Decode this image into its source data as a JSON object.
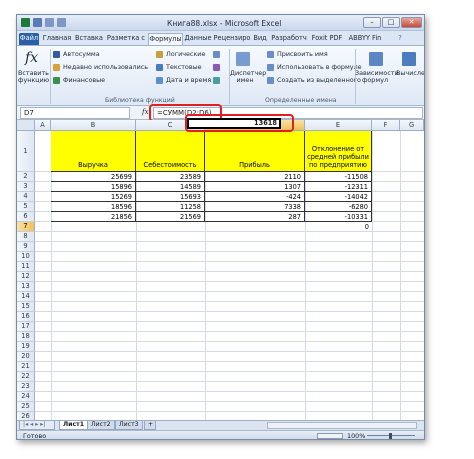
{
  "window": {
    "title": "Книга88.xlsx - Microsoft Excel",
    "minimize_label": "–",
    "restore_label": "□",
    "close_label": "✕"
  },
  "ribbon_tabs": [
    "Файл",
    "Главная",
    "Вставка",
    "Разметка с",
    "Формулы",
    "Данные",
    "Рецензиро",
    "Вид",
    "Разработч",
    "Foxit PDF",
    "ABBYY Fin"
  ],
  "active_tab": "Формулы",
  "ribbon": {
    "insert_function": "Вставить функцию",
    "autosum": "Автосумма",
    "recent": "Недавно использовались",
    "financial": "Финансовые",
    "logical": "Логические",
    "text": "Текстовые",
    "datetime": "Дата и время",
    "library_group": "Библиотека функций",
    "name_manager": "Диспетчер имен",
    "assign_name": "Присвоить имя",
    "use_in_formula": "Использовать в формуле",
    "create_from_selection": "Создать из выделенного",
    "defined_names_group": "Определенные имена",
    "dependencies": "Зависимости формул",
    "calculation": "Вычисление"
  },
  "formula_bar": {
    "name_box": "D7",
    "fx": "fx",
    "formula": "=СУММ(D2:D6)"
  },
  "columns": [
    "A",
    "B",
    "C",
    "D",
    "E",
    "F",
    "G"
  ],
  "selected_column": "D",
  "rows": [
    "1",
    "2",
    "3",
    "4",
    "5",
    "6",
    "7",
    "8",
    "9",
    "10",
    "11",
    "12",
    "13",
    "14",
    "15",
    "16",
    "17",
    "18",
    "19",
    "20",
    "21",
    "22",
    "23",
    "24",
    "25",
    "26",
    "27",
    "28",
    "29"
  ],
  "selected_row": "7",
  "table": {
    "headers": [
      "Выручка",
      "Себестоимость",
      "Прибыль",
      "Отклонение от средней прибыли по предприятию"
    ],
    "data": [
      [
        "25699",
        "23589",
        "2110",
        "-11508"
      ],
      [
        "15896",
        "14589",
        "1307",
        "-12311"
      ],
      [
        "15269",
        "15693",
        "-424",
        "-14042"
      ],
      [
        "18596",
        "11258",
        "7338",
        "-6280"
      ],
      [
        "21856",
        "21569",
        "287",
        "-10331"
      ]
    ],
    "total_profit": "13618",
    "total_deviation": "0"
  },
  "sheets": [
    "Лист1",
    "Лист2",
    "Лист3"
  ],
  "active_sheet": "Лист1",
  "status": {
    "ready": "Готово",
    "zoom": "100%"
  },
  "colors": {
    "header_fill": "#ffff00",
    "highlight": "#e02020",
    "file_tab": "#2a5fa8"
  }
}
